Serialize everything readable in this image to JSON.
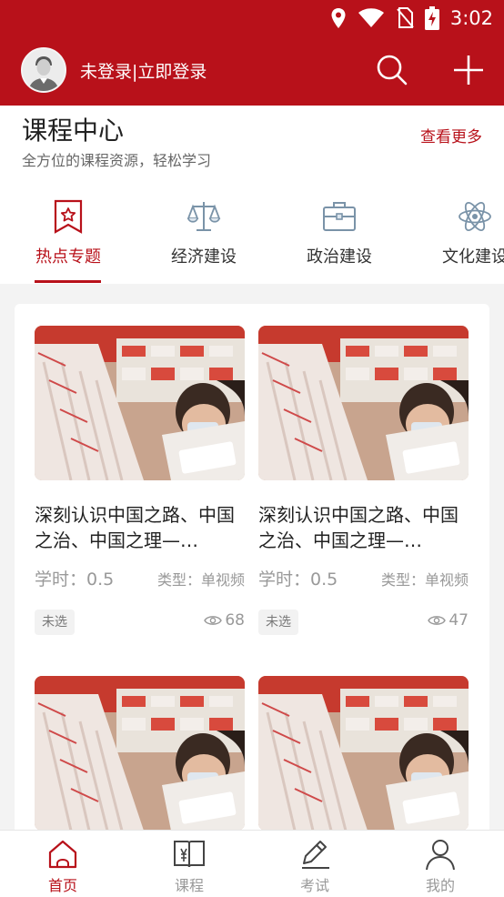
{
  "status_bar": {
    "time": "3:02"
  },
  "app_bar": {
    "login_text": "未登录|立即登录"
  },
  "course_center": {
    "title": "课程中心",
    "subtitle": "全方位的课程资源，轻松学习",
    "more_label": "查看更多",
    "tabs": [
      {
        "label": "热点专题",
        "icon": "bookmark-star-icon",
        "active": true
      },
      {
        "label": "经济建设",
        "icon": "scale-icon",
        "active": false
      },
      {
        "label": "政治建设",
        "icon": "briefcase-icon",
        "active": false
      },
      {
        "label": "文化建设",
        "icon": "atom-icon",
        "active": false
      }
    ]
  },
  "courses": [
    {
      "title": "深刻认识中国之路、中国之治、中国之理—…",
      "hours": "学时：0.5",
      "type": "类型：单视频",
      "status": "未选",
      "views": "68"
    },
    {
      "title": "深刻认识中国之路、中国之治、中国之理—…",
      "hours": "学时：0.5",
      "type": "类型：单视频",
      "status": "未选",
      "views": "47"
    },
    {
      "title": "",
      "hours": "",
      "type": "",
      "status": "",
      "views": ""
    },
    {
      "title": "",
      "hours": "",
      "type": "",
      "status": "",
      "views": ""
    }
  ],
  "bottom_nav": [
    {
      "label": "首页",
      "icon": "home-icon",
      "active": true
    },
    {
      "label": "课程",
      "icon": "book-icon",
      "active": false
    },
    {
      "label": "考试",
      "icon": "pen-icon",
      "active": false
    },
    {
      "label": "我的",
      "icon": "user-icon",
      "active": false
    }
  ],
  "colors": {
    "brand": "#b8111a",
    "muted": "#999999",
    "tab_icon": "#7a93a8"
  }
}
